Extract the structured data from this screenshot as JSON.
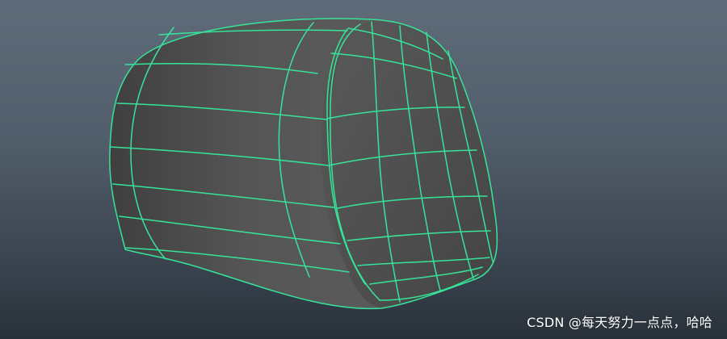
{
  "viewport": {
    "background_top": "#5f6b78",
    "background_bottom": "#29313a"
  },
  "object": {
    "icon": "polygon-mesh-cushion",
    "fill_color": "#565656",
    "side_color": "#4a4a4a",
    "wire_color": "#37e39a"
  },
  "watermark": {
    "text": "CSDN @每天努力一点点，哈哈"
  }
}
